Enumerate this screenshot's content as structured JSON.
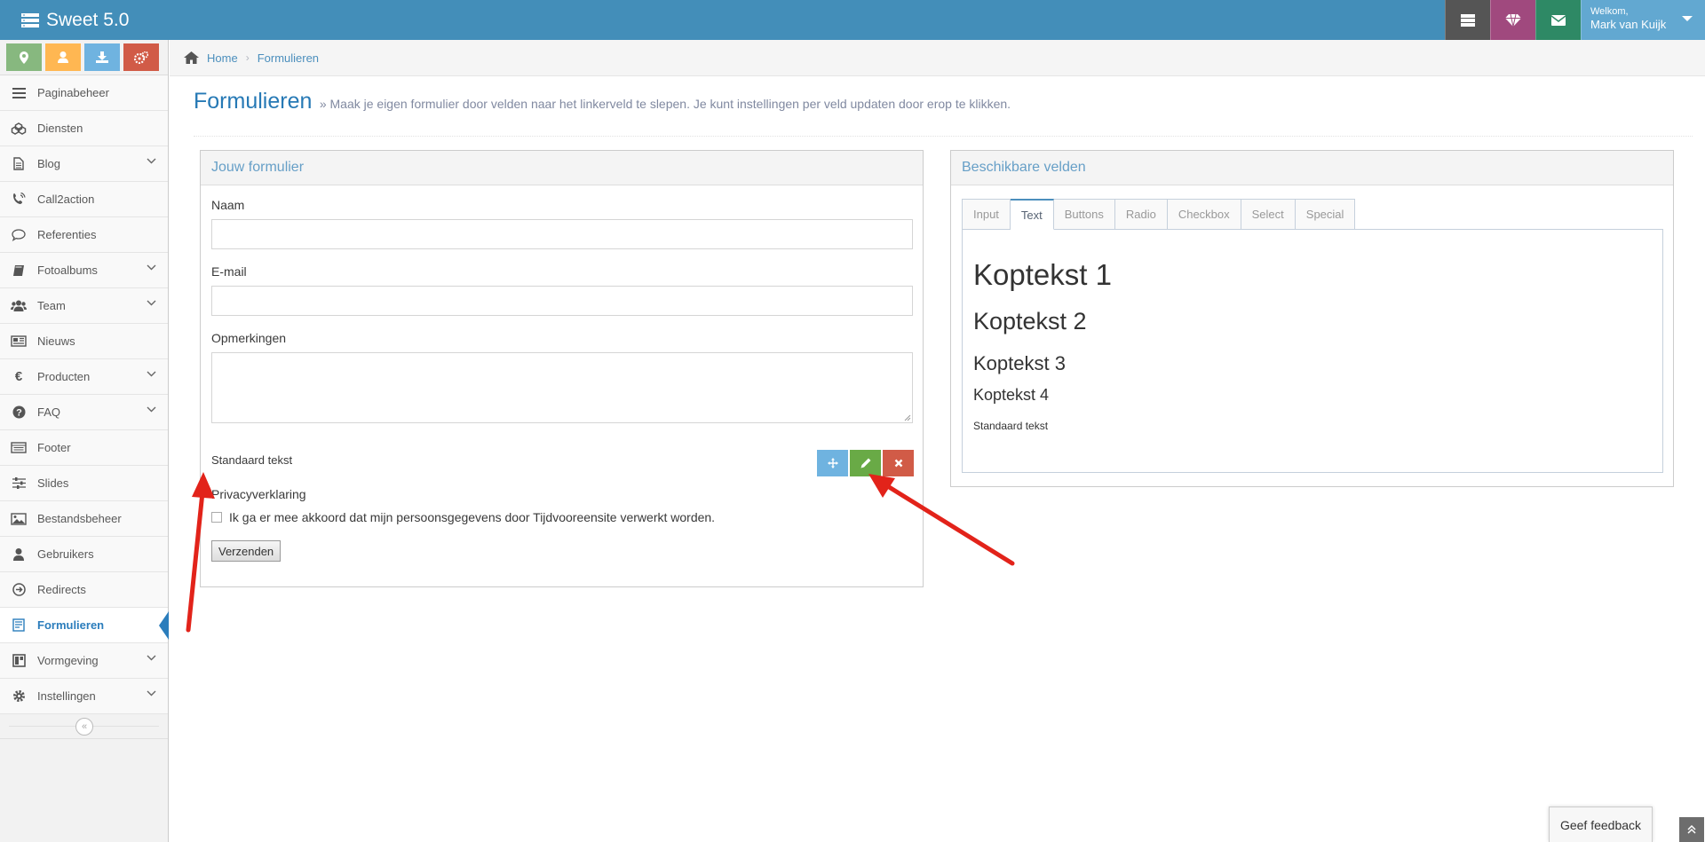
{
  "app": {
    "title": "Sweet 5.0"
  },
  "navbar": {
    "welcome_label": "Welkom,",
    "user_name": "Mark van Kuijk"
  },
  "sidebar": {
    "shortcut_icons": [
      "map-marker-icon",
      "user-icon",
      "download-icon",
      "cogs-icon"
    ],
    "items": [
      {
        "label": "Paginabeheer",
        "icon": "bars-icon",
        "has_submenu": false
      },
      {
        "label": "Diensten",
        "icon": "cubes-icon",
        "has_submenu": false
      },
      {
        "label": "Blog",
        "icon": "file-icon",
        "has_submenu": true
      },
      {
        "label": "Call2action",
        "icon": "phone-volume-icon",
        "has_submenu": false
      },
      {
        "label": "Referenties",
        "icon": "comment-icon",
        "has_submenu": false
      },
      {
        "label": "Fotoalbums",
        "icon": "book-icon",
        "has_submenu": true
      },
      {
        "label": "Team",
        "icon": "users-icon",
        "has_submenu": true
      },
      {
        "label": "Nieuws",
        "icon": "newspaper-icon",
        "has_submenu": false
      },
      {
        "label": "Producten",
        "icon": "euro-icon",
        "has_submenu": true
      },
      {
        "label": "FAQ",
        "icon": "question-circle-icon",
        "has_submenu": true
      },
      {
        "label": "Footer",
        "icon": "list-alt-icon",
        "has_submenu": false
      },
      {
        "label": "Slides",
        "icon": "sliders-icon",
        "has_submenu": false
      },
      {
        "label": "Bestandsbeheer",
        "icon": "image-icon",
        "has_submenu": false
      },
      {
        "label": "Gebruikers",
        "icon": "user-icon",
        "has_submenu": false
      },
      {
        "label": "Redirects",
        "icon": "arrow-circle-right-icon",
        "has_submenu": false
      },
      {
        "label": "Formulieren",
        "icon": "form-icon",
        "has_submenu": false,
        "active": true
      },
      {
        "label": "Vormgeving",
        "icon": "layout-icon",
        "has_submenu": true
      },
      {
        "label": "Instellingen",
        "icon": "cog-icon",
        "has_submenu": true
      }
    ],
    "collapse_glyph": "«"
  },
  "breadcrumb": {
    "home": "Home",
    "current": "Formulieren"
  },
  "page": {
    "title": "Formulieren",
    "subtitle": "» Maak je eigen formulier door velden naar het linkerveld te slepen. Je kunt instellingen per veld updaten door erop te klikken."
  },
  "form_widget": {
    "title": "Jouw formulier",
    "fields": {
      "naam_label": "Naam",
      "email_label": "E-mail",
      "opmerkingen_label": "Opmerkingen",
      "standard_text": "Standaard tekst",
      "privacy_label": "Privacyverklaring",
      "privacy_checkbox_text": "Ik ga er mee akkoord dat mijn persoonsgegevens door Tijdvooreensite verwerkt worden."
    },
    "submit_label": "Verzenden"
  },
  "fields_widget": {
    "title": "Beschikbare velden",
    "tabs": [
      "Input",
      "Text",
      "Buttons",
      "Radio",
      "Checkbox",
      "Select",
      "Special"
    ],
    "active_tab": "Text",
    "text_items": {
      "h1": "Koptekst 1",
      "h2": "Koptekst 2",
      "h3": "Koptekst 3",
      "h4": "Koptekst 4",
      "p": "Standaard tekst"
    }
  },
  "feedback": {
    "label": "Geef feedback"
  },
  "colors": {
    "navbar": "#438eb9",
    "accent_blue": "#2b7dbc",
    "annotation_arrow": "#e2231a"
  }
}
